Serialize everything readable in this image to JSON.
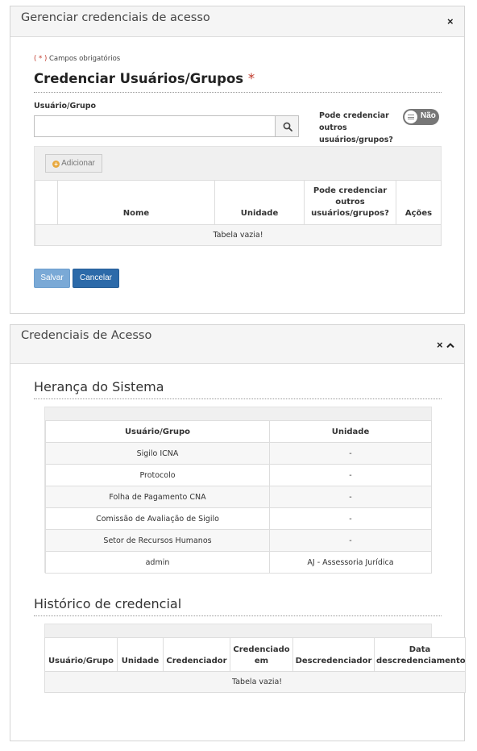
{
  "panel1": {
    "title": "Gerenciar credenciais de acesso",
    "close_icon": "close-icon",
    "required_note_star": "( * )",
    "required_note_text": "Campos obrigatórios",
    "section_title": "Credenciar Usuários/Grupos",
    "section_star": "*",
    "field_label": "Usuário/Grupo",
    "search_input_value": "",
    "search_icon": "search-icon",
    "pode_label": "Pode credenciar outros usuários/grupos?",
    "toggle_label": "Não",
    "add_button_label": "Adicionar",
    "table": {
      "headers": [
        "",
        "Nome",
        "Unidade",
        "Pode credenciar outros usuários/grupos?",
        "Ações"
      ],
      "empty_text": "Tabela vazia!"
    },
    "save_label": "Salvar",
    "cancel_label": "Cancelar"
  },
  "panel2": {
    "title": "Credenciais de Acesso",
    "close_icon": "close-icon",
    "collapse_icon": "chevron-up-icon",
    "heranca_title": "Herança do Sistema",
    "heranca_table": {
      "headers": [
        "Usuário/Grupo",
        "Unidade"
      ],
      "rows": [
        [
          "Sigilo ICNA",
          "-"
        ],
        [
          "Protocolo",
          "-"
        ],
        [
          "Folha de Pagamento CNA",
          "-"
        ],
        [
          "Comissão de Avaliação de Sigilo",
          "-"
        ],
        [
          "Setor de Recursos Humanos",
          "-"
        ],
        [
          "admin",
          "AJ - Assessoria Jurídica"
        ]
      ]
    },
    "historico_title": "Histórico de credencial",
    "historico_table": {
      "headers": [
        "Usuário/Grupo",
        "Unidade",
        "Credenciador",
        "Credenciado em",
        "Descredenciador",
        "Data descredenciamento"
      ],
      "empty_text": "Tabela vazia!"
    }
  },
  "colors": {
    "required_star": "#c0392b",
    "save_button": "#7aa9d6",
    "cancel_button": "#2c6aa9",
    "toggle_off": "#777777",
    "add_plus": "#e8a93f"
  }
}
